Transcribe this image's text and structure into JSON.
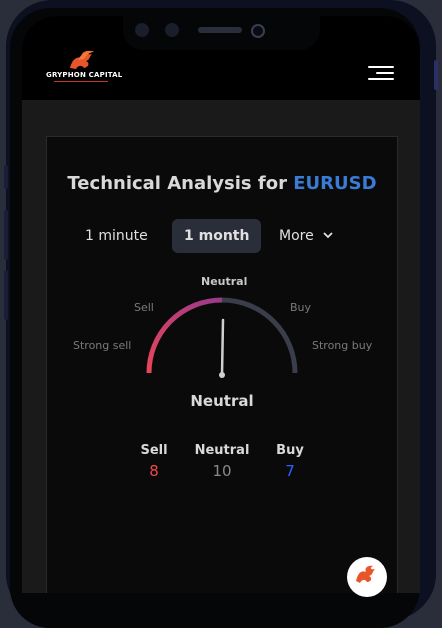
{
  "brand": {
    "name": "GRYPHON CAPITAL"
  },
  "widget": {
    "title_prefix": "Technical Analysis for",
    "symbol": "EURUSD",
    "tabs": [
      "1 minute",
      "1 month",
      "More"
    ],
    "active_tab": "1 month",
    "gauge_labels": {
      "strong_sell": "Strong sell",
      "sell": "Sell",
      "neutral": "Neutral",
      "buy": "Buy",
      "strong_buy": "Strong buy"
    },
    "verdict": "Neutral",
    "counts": [
      {
        "label": "Sell",
        "value": "8"
      },
      {
        "label": "Neutral",
        "value": "10"
      },
      {
        "label": "Buy",
        "value": "7"
      }
    ],
    "colors": {
      "accent": "#3a7bd5",
      "sell": "#f24848",
      "buy": "#2962ff",
      "neutral": "#8a8a8a"
    }
  },
  "icons": {
    "menu": "hamburger-icon",
    "chevron": "chevron-down-icon",
    "logo": "gryphon-logo-icon"
  }
}
